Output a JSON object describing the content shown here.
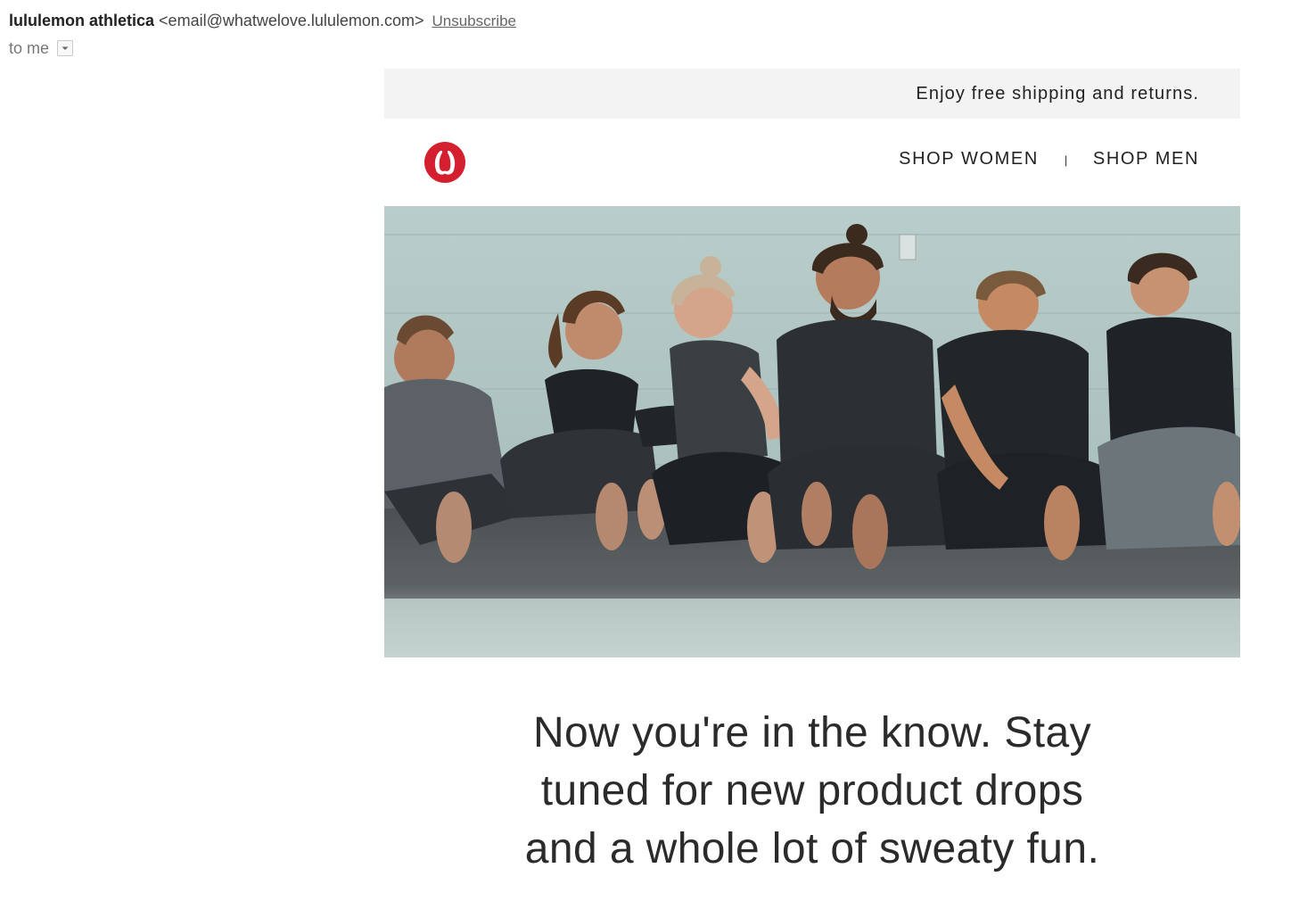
{
  "email": {
    "sender_name": "lululemon athletica",
    "sender_email": "<email@whatwelove.lululemon.com>",
    "unsubscribe_label": "Unsubscribe",
    "recipient_label": "to me",
    "recipient_menu_icon": "chevron-down-icon"
  },
  "promo": {
    "text": "Enjoy free shipping and returns."
  },
  "nav": {
    "logo_icon": "lululemon-logo-icon",
    "shop_women_label": "SHOP WOMEN",
    "separator": "|",
    "shop_men_label": "SHOP MEN"
  },
  "hero": {
    "image": "group-of-people-sitting-on-floor-laughing"
  },
  "headline": {
    "lines": [
      "Now you're in the know. Stay",
      "tuned for new product drops",
      "and a whole lot of sweaty fun."
    ]
  },
  "colors": {
    "brand_red": "#d31f2e",
    "promo_bar_bg": "#f3f3f3",
    "text_dark": "#222222"
  }
}
